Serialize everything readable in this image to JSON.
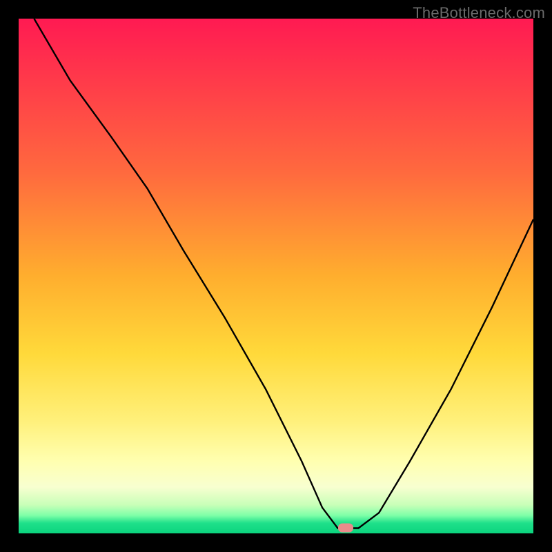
{
  "watermark": "TheBottleneck.com",
  "marker": {
    "x_frac": 0.635,
    "y_frac": 0.989,
    "w": 22,
    "h": 13
  },
  "chart_data": {
    "type": "line",
    "title": "",
    "xlabel": "",
    "ylabel": "",
    "xlim": [
      0,
      100
    ],
    "ylim": [
      0,
      100
    ],
    "grid": false,
    "legend": false,
    "annotations": [
      "TheBottleneck.com"
    ],
    "background_gradient": {
      "orientation": "vertical",
      "stops": [
        {
          "pos": 0.0,
          "color": "#ff1a52"
        },
        {
          "pos": 0.3,
          "color": "#ff6a3e"
        },
        {
          "pos": 0.5,
          "color": "#ffae2e"
        },
        {
          "pos": 0.7,
          "color": "#ffe84a"
        },
        {
          "pos": 0.88,
          "color": "#ffffc0"
        },
        {
          "pos": 0.97,
          "color": "#7fffa8"
        },
        {
          "pos": 1.0,
          "color": "#0bd47e"
        }
      ]
    },
    "marker_point": {
      "x": 63.5,
      "y": 1
    },
    "series": [
      {
        "name": "bottleneck-curve",
        "x": [
          3,
          10,
          18,
          25,
          32,
          40,
          48,
          55,
          59,
          62,
          66,
          70,
          76,
          84,
          92,
          100
        ],
        "y": [
          100,
          88,
          77,
          67,
          55,
          42,
          28,
          14,
          5,
          1,
          1,
          4,
          14,
          28,
          44,
          61
        ]
      }
    ]
  }
}
